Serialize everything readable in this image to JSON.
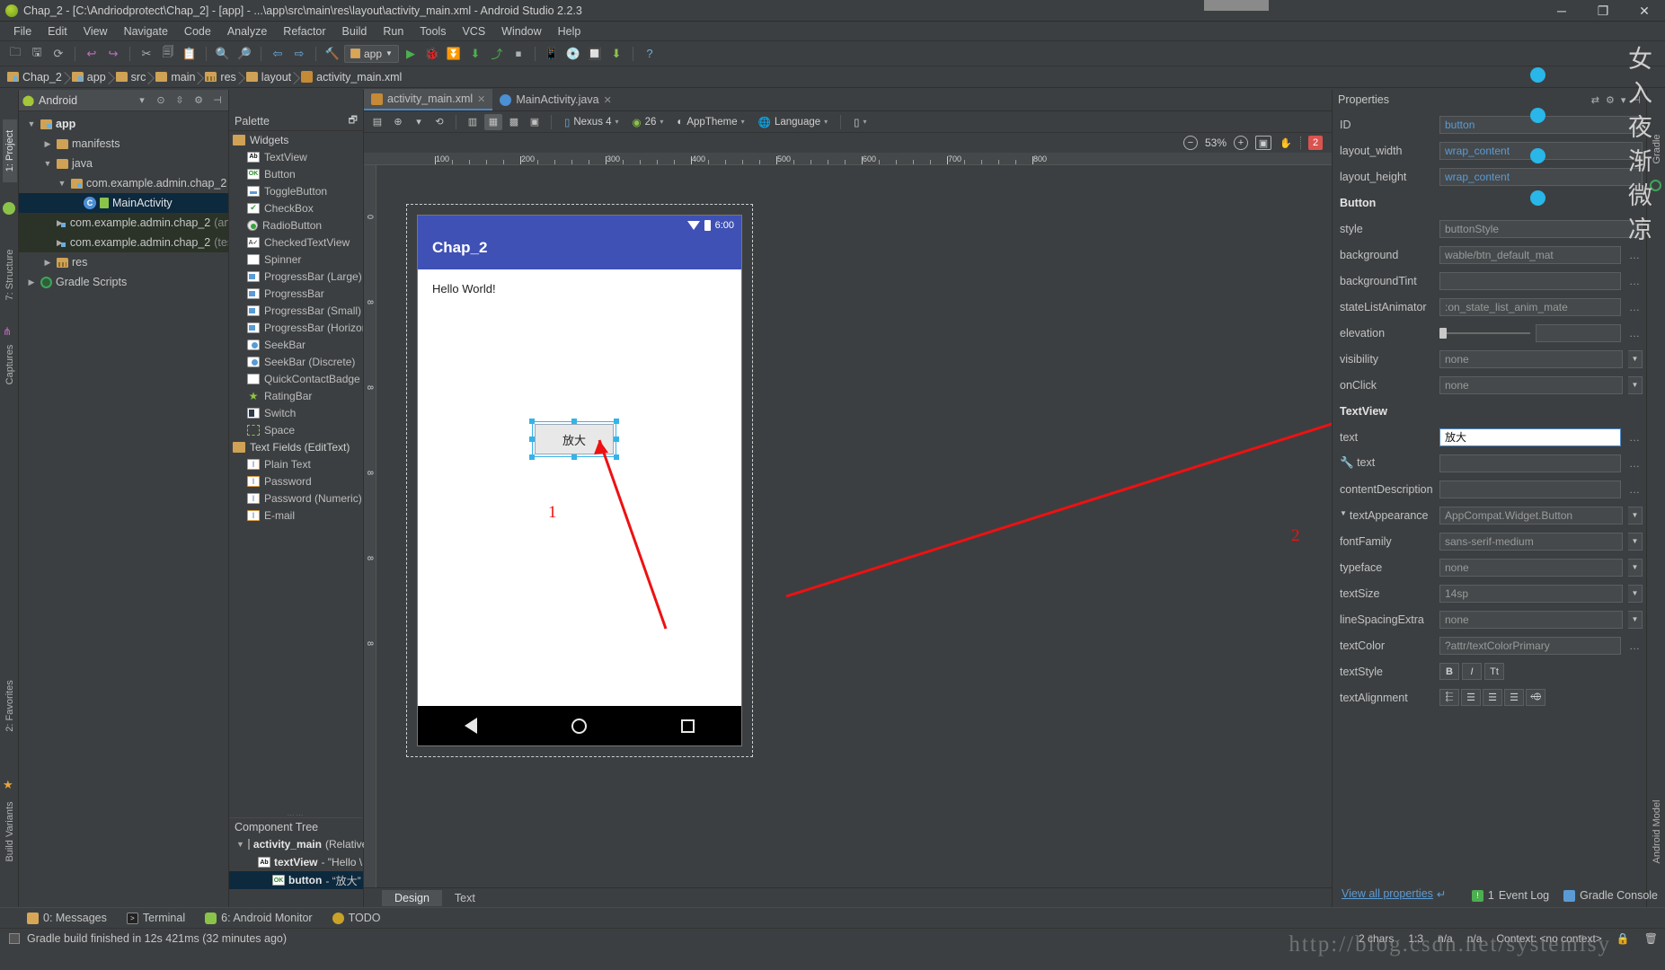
{
  "window": {
    "title": "Chap_2 - [C:\\Andriodprotect\\Chap_2] - [app] - ...\\app\\src\\main\\res\\layout\\activity_main.xml - Android Studio 2.2.3",
    "minimize": "─",
    "maximize": "❐",
    "close": "✕"
  },
  "menu": [
    "File",
    "Edit",
    "View",
    "Navigate",
    "Code",
    "Analyze",
    "Refactor",
    "Build",
    "Run",
    "Tools",
    "VCS",
    "Window",
    "Help"
  ],
  "toolbar": {
    "run_config": "app",
    "icons": [
      "open-folder",
      "save-all",
      "sync",
      "undo",
      "redo",
      "cut",
      "copy",
      "paste",
      "find",
      "replace",
      "back",
      "forward",
      "build",
      "run",
      "debug",
      "debug-step",
      "attach-debugger",
      "profiler",
      "stop",
      "avd-manager",
      "sdk-manager",
      "layout-inspector",
      "gradle-sync",
      "help"
    ]
  },
  "breadcrumb": [
    {
      "label": "Chap_2",
      "icon": "module-folder"
    },
    {
      "label": "app",
      "icon": "module-folder"
    },
    {
      "label": "src",
      "icon": "folder"
    },
    {
      "label": "main",
      "icon": "folder"
    },
    {
      "label": "res",
      "icon": "res-folder"
    },
    {
      "label": "layout",
      "icon": "folder"
    },
    {
      "label": "activity_main.xml",
      "icon": "xml-file"
    }
  ],
  "project": {
    "header_label": "Android",
    "tree": [
      {
        "depth": 0,
        "label": "app",
        "icon": "module-folder",
        "arrow": "▼",
        "state": "normal"
      },
      {
        "depth": 1,
        "label": "manifests",
        "icon": "folder",
        "arrow": "▶",
        "state": "normal"
      },
      {
        "depth": 1,
        "label": "java",
        "icon": "folder",
        "arrow": "▼",
        "state": "normal"
      },
      {
        "depth": 2,
        "label": "com.example.admin.chap_2",
        "icon": "package",
        "arrow": "▼",
        "state": "normal"
      },
      {
        "depth": 3,
        "label": "MainActivity",
        "icon": "class",
        "arrow": "",
        "state": "selected"
      },
      {
        "depth": 2,
        "label": "com.example.admin.chap_2",
        "suffix": "(androidTest)",
        "icon": "package",
        "arrow": "▶",
        "state": "test"
      },
      {
        "depth": 2,
        "label": "com.example.admin.chap_2",
        "suffix": "(test)",
        "icon": "package",
        "arrow": "▶",
        "state": "test"
      },
      {
        "depth": 1,
        "label": "res",
        "icon": "res-folder",
        "arrow": "▶",
        "state": "normal"
      },
      {
        "depth": 0,
        "label": "Gradle Scripts",
        "icon": "gradle",
        "arrow": "▶",
        "state": "normal"
      }
    ]
  },
  "left_rail": [
    "1: Project",
    "7: Structure",
    "Captures",
    "2: Favorites",
    "Build Variants"
  ],
  "right_rail": [
    "Gradle",
    "Android Model"
  ],
  "palette": {
    "title": "Palette",
    "items": [
      {
        "label": "Widgets",
        "icon": "folder",
        "group": true
      },
      {
        "label": "TextView",
        "icon": "textview"
      },
      {
        "label": "Button",
        "icon": "button"
      },
      {
        "label": "ToggleButton",
        "icon": "togglebutton"
      },
      {
        "label": "CheckBox",
        "icon": "checkbox"
      },
      {
        "label": "RadioButton",
        "icon": "radiobutton"
      },
      {
        "label": "CheckedTextView",
        "icon": "checkedtextview"
      },
      {
        "label": "Spinner",
        "icon": "spinner"
      },
      {
        "label": "ProgressBar (Large)",
        "icon": "progressbar"
      },
      {
        "label": "ProgressBar",
        "icon": "progressbar"
      },
      {
        "label": "ProgressBar (Small)",
        "icon": "progressbar"
      },
      {
        "label": "ProgressBar (Horizont",
        "icon": "progressbar"
      },
      {
        "label": "SeekBar",
        "icon": "seekbar"
      },
      {
        "label": "SeekBar (Discrete)",
        "icon": "seekbar"
      },
      {
        "label": "QuickContactBadge",
        "icon": "quickcontactbadge"
      },
      {
        "label": "RatingBar",
        "icon": "ratingbar"
      },
      {
        "label": "Switch",
        "icon": "switch"
      },
      {
        "label": "Space",
        "icon": "space"
      },
      {
        "label": "Text Fields (EditText)",
        "icon": "folder",
        "group": true
      },
      {
        "label": "Plain Text",
        "icon": "edittext"
      },
      {
        "label": "Password",
        "icon": "edittext"
      },
      {
        "label": "Password (Numeric)",
        "icon": "edittext"
      },
      {
        "label": "E-mail",
        "icon": "edittext"
      }
    ]
  },
  "component_tree": {
    "title": "Component Tree",
    "rows": [
      {
        "depth": 0,
        "name": "activity_main",
        "detail": " (Relative",
        "icon": "relativelayout",
        "arrow": "▼",
        "selected": false
      },
      {
        "depth": 1,
        "name": "textView",
        "detail": " - \"Hello \\",
        "icon": "textview",
        "arrow": "",
        "selected": false
      },
      {
        "depth": 2,
        "name": "button",
        "detail": " - “放大”",
        "icon": "button",
        "arrow": "",
        "selected": true
      }
    ]
  },
  "editor_tabs": [
    {
      "label": "activity_main.xml",
      "icon": "xml-file",
      "active": true,
      "close": "✕"
    },
    {
      "label": "MainActivity.java",
      "icon": "java-file",
      "active": false,
      "close": "✕"
    }
  ],
  "design_toolbar": {
    "device": "Nexus 4",
    "api": "26",
    "theme": "AppTheme",
    "language": "Language",
    "orientation": "portrait"
  },
  "zoom": {
    "level": "53%",
    "minus": "⊖",
    "plus": "⊕",
    "fit": "fit-screen",
    "pan": "pan",
    "issue_count": "2"
  },
  "ruler": {
    "h_ticks": [
      "100",
      "200",
      "300",
      "400",
      "500",
      "600",
      "700",
      "800"
    ]
  },
  "preview": {
    "status_time": "6:00",
    "app_title": "Chap_2",
    "hello_text": "Hello World!",
    "button_text": "放大",
    "nav": [
      "back",
      "home",
      "recents"
    ]
  },
  "annotations": {
    "one": "1",
    "two": "2"
  },
  "design_text_tabs": [
    {
      "label": "Design",
      "active": true
    },
    {
      "label": "Text",
      "active": false
    }
  ],
  "properties": {
    "title": "Properties",
    "view_all": "View all properties",
    "rows": [
      {
        "key": "ID",
        "value": "button",
        "type": "link"
      },
      {
        "key": "layout_width",
        "value": "wrap_content",
        "type": "link"
      },
      {
        "key": "layout_height",
        "value": "wrap_content",
        "type": "link"
      },
      {
        "key": "Button",
        "type": "section"
      },
      {
        "key": "style",
        "value": "buttonStyle",
        "type": "text"
      },
      {
        "key": "background",
        "value": "wable/btn_default_mat",
        "type": "text",
        "dots": true
      },
      {
        "key": "backgroundTint",
        "value": "",
        "type": "text",
        "dots": true
      },
      {
        "key": "stateListAnimator",
        "value": ":on_state_list_anim_mate",
        "type": "text",
        "dots": true
      },
      {
        "key": "elevation",
        "value": "",
        "type": "slider",
        "dots": true
      },
      {
        "key": "visibility",
        "value": "none",
        "type": "dropdown"
      },
      {
        "key": "onClick",
        "value": "none",
        "type": "dropdown"
      },
      {
        "key": "TextView",
        "type": "section"
      },
      {
        "key": "text",
        "value": "放大",
        "type": "editing",
        "dots": true
      },
      {
        "key": "text",
        "value": "",
        "type": "text",
        "icon": "wrench",
        "dots": true
      },
      {
        "key": "contentDescription",
        "value": "",
        "type": "text",
        "dots": true
      },
      {
        "key": "textAppearance",
        "value": "AppCompat.Widget.Button",
        "type": "dropdown",
        "expander": "▼"
      },
      {
        "key": "fontFamily",
        "value": "sans-serif-medium",
        "type": "dropdown"
      },
      {
        "key": "typeface",
        "value": "none",
        "type": "dropdown"
      },
      {
        "key": "textSize",
        "value": "14sp",
        "type": "dropdown"
      },
      {
        "key": "lineSpacingExtra",
        "value": "none",
        "type": "dropdown"
      },
      {
        "key": "textColor",
        "value": "?attr/textColorPrimary",
        "type": "text",
        "dots": true
      },
      {
        "key": "textStyle",
        "value": "",
        "type": "stylebuttons",
        "buttons": [
          "B",
          "I",
          "Tt"
        ]
      },
      {
        "key": "textAlignment",
        "value": "",
        "type": "alignbuttons"
      }
    ]
  },
  "bottom_tools": [
    {
      "label": "0: Messages",
      "icon": "messages-icon"
    },
    {
      "label": "Terminal",
      "icon": "terminal-icon"
    },
    {
      "label": "6: Android Monitor",
      "icon": "android-icon"
    },
    {
      "label": "TODO",
      "icon": "todo-icon"
    }
  ],
  "status": {
    "build_message": "Gradle build finished in 12s 421ms (32 minutes ago)",
    "chars": "2 chars",
    "caret": "1:3",
    "encoding": "n/a",
    "line_sep": "n/a",
    "context": "Context: <no context>",
    "event_log": "Event Log",
    "event_count": "1",
    "gradle_console": "Gradle Console"
  },
  "watermark": {
    "url": "http://blog.csdn.net/systemlsy",
    "cjk": "女入夜渐微凉"
  },
  "colors": {
    "accent": "#4a88c7",
    "appbar": "#3f51b5",
    "annotation": "#ee1111",
    "badge": "#d9534f",
    "selection": "#0d293e"
  }
}
